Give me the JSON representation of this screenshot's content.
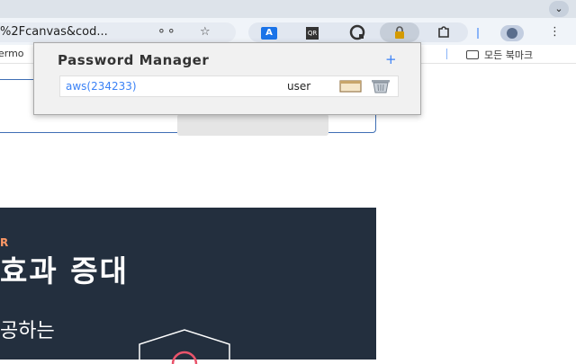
{
  "browser": {
    "url_fragment": "%2Fcanvas&cod...",
    "bookmark_partial": "ermo",
    "all_bookmarks_label": "모든 북마크",
    "extension_translate_label": "A",
    "extension_qr_label": "QR"
  },
  "page": {
    "hero_eyebrow": "R",
    "hero_title": "효과 증대",
    "hero_subtitle": "공하는"
  },
  "password_manager": {
    "title": "Password Manager",
    "add_label": "+",
    "entries": [
      {
        "site": "aws(234233)",
        "username": "user"
      }
    ]
  },
  "colors": {
    "hero_bg": "#232f3e",
    "accent": "#ff9966",
    "link": "#3b82f6"
  }
}
